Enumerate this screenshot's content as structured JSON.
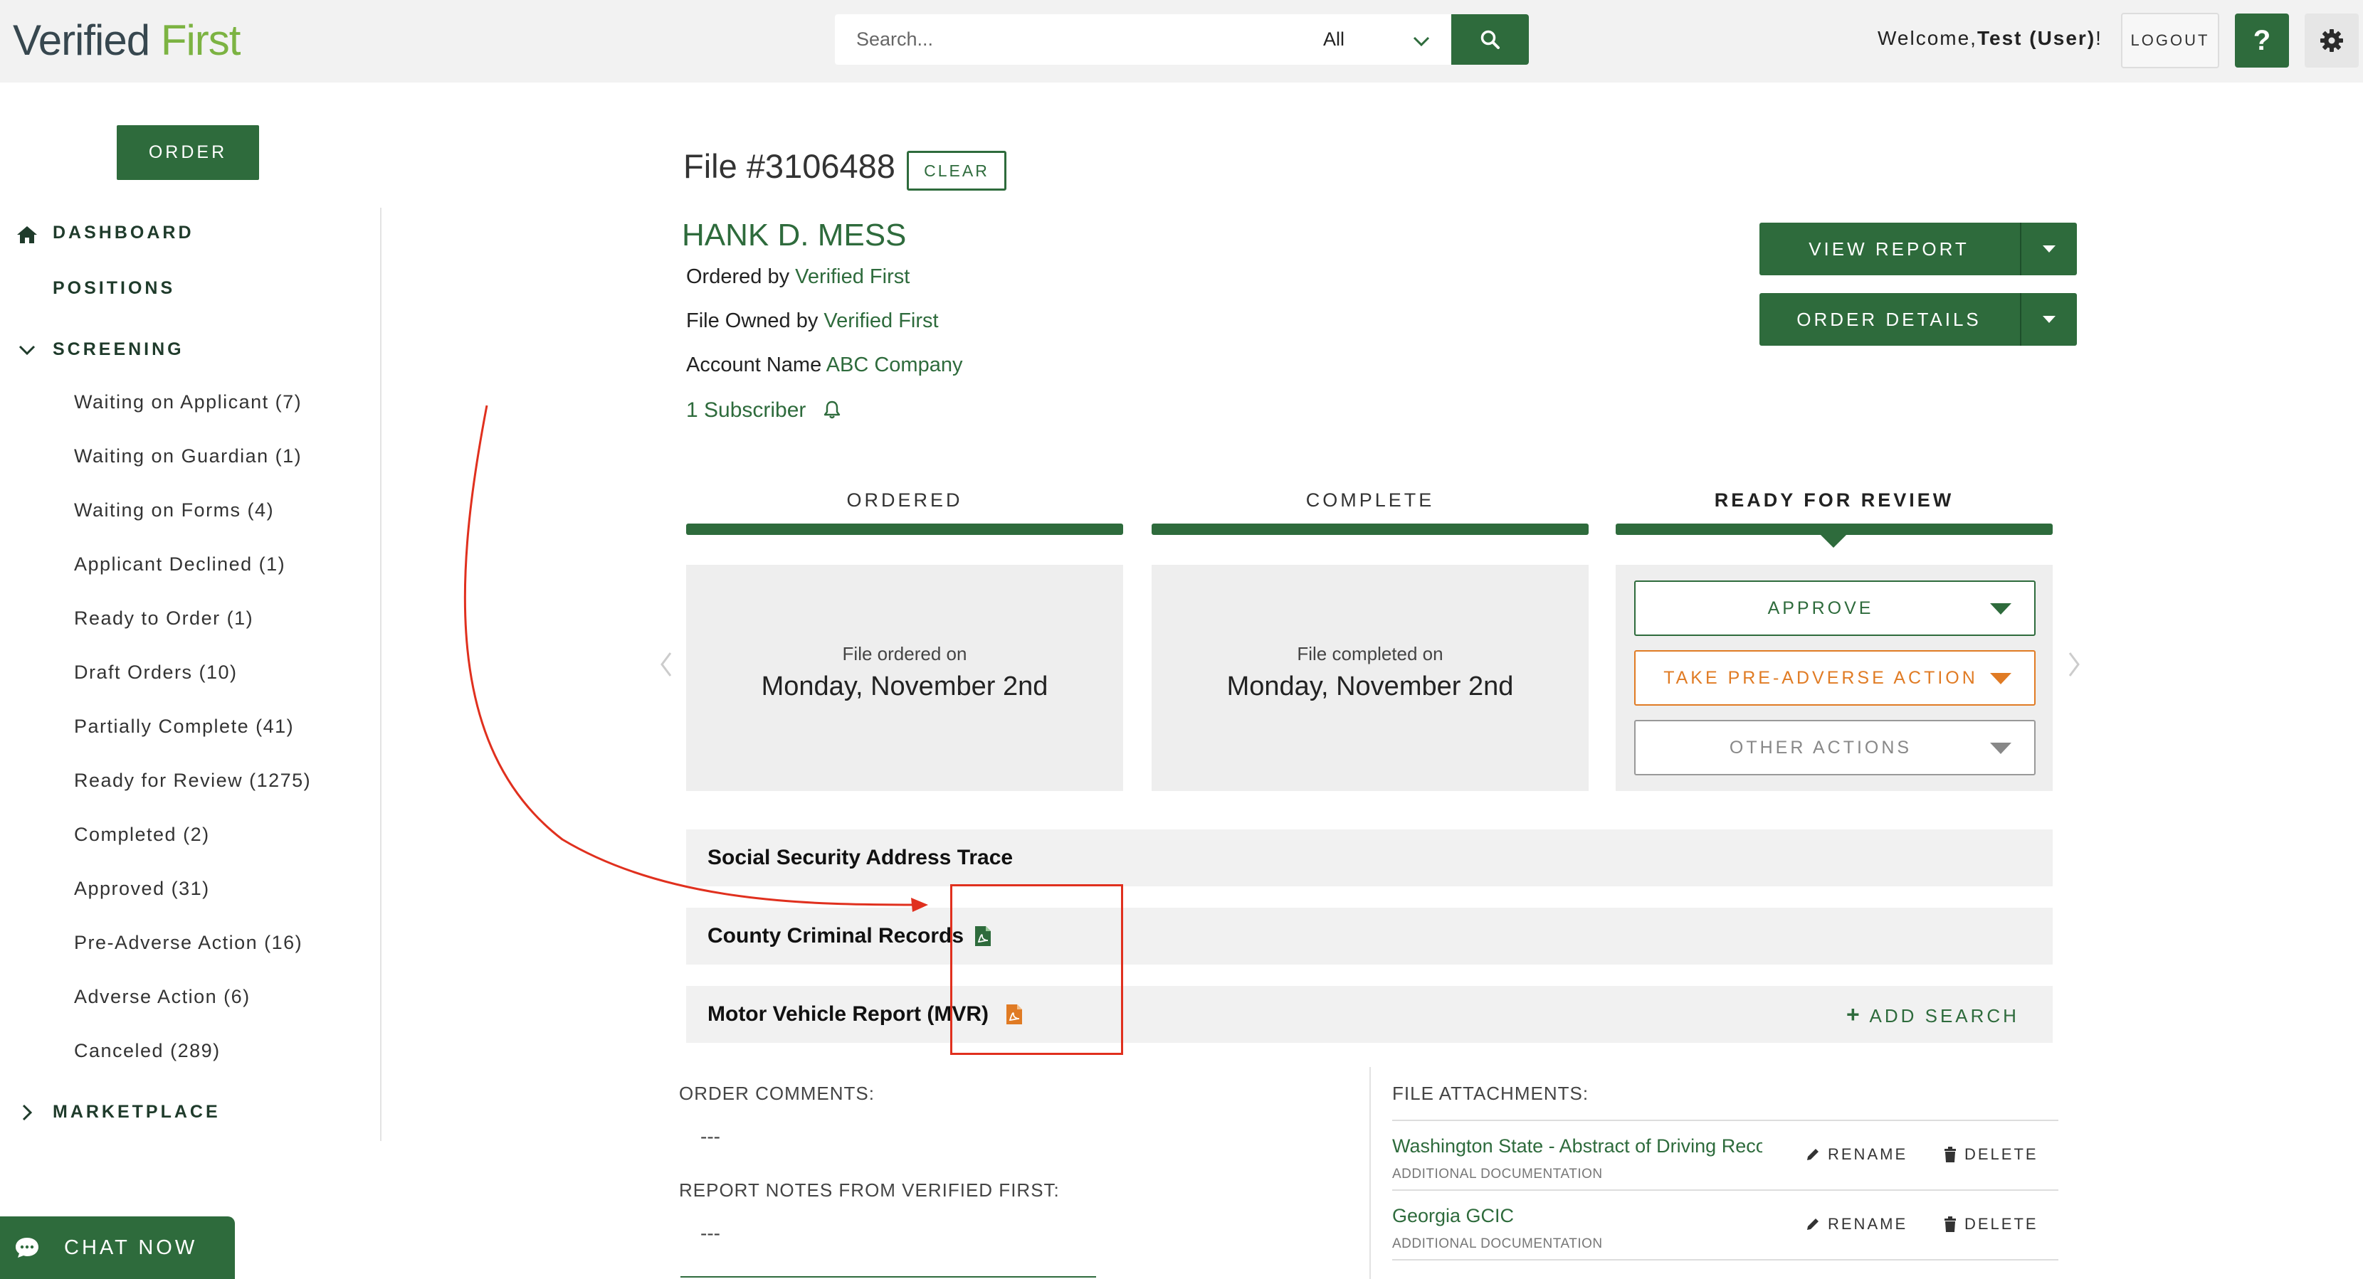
{
  "header": {
    "logo_part1": "Verified",
    "logo_part2": "First",
    "search_placeholder": "Search...",
    "search_scope": "All",
    "welcome_prefix": "Welcome,",
    "welcome_user": "Test (User)",
    "welcome_suffix": "!",
    "logout_label": "LOGOUT",
    "help_label": "?"
  },
  "sidebar": {
    "order_label": "ORDER",
    "dashboard": "DASHBOARD",
    "positions": "POSITIONS",
    "screening": "SCREENING",
    "marketplace": "MARKETPLACE",
    "items": [
      "Waiting on Applicant (7)",
      "Waiting on Guardian (1)",
      "Waiting on Forms (4)",
      "Applicant Declined (1)",
      "Ready to Order (1)",
      "Draft Orders (10)",
      "Partially Complete (41)",
      "Ready for Review (1275)",
      "Completed (2)",
      "Approved (31)",
      "Pre-Adverse Action (16)",
      "Adverse Action (6)",
      "Canceled (289)"
    ],
    "chat_label": "CHAT NOW"
  },
  "file": {
    "title": "File #3106488",
    "clear_label": "CLEAR",
    "candidate_name": "HANK D. MESS",
    "ordered_by_label": "Ordered by",
    "ordered_by_value": "Verified First",
    "owned_by_label": "File Owned by",
    "owned_by_value": "Verified First",
    "account_label": "Account Name",
    "account_value": "ABC Company",
    "subscriber_text": "1 Subscriber",
    "view_report_label": "VIEW REPORT",
    "order_details_label": "ORDER DETAILS"
  },
  "stages": {
    "ordered_label": "ORDERED",
    "complete_label": "COMPLETE",
    "review_label": "READY FOR REVIEW",
    "ordered_sub": "File ordered on",
    "ordered_date": "Monday, November 2nd",
    "completed_sub": "File completed on",
    "completed_date": "Monday, November 2nd",
    "approve_label": "APPROVE",
    "pre_adverse_label": "TAKE PRE-ADVERSE ACTION",
    "other_actions_label": "OTHER ACTIONS"
  },
  "searches": {
    "items": [
      "Social Security Address Trace",
      "County Criminal Records",
      "Motor Vehicle Report (MVR)"
    ],
    "add_search_label": "ADD SEARCH"
  },
  "comments": {
    "order_comments_label": "ORDER COMMENTS:",
    "order_comments_value": "---",
    "report_notes_label": "REPORT NOTES FROM VERIFIED FIRST:",
    "report_notes_value": "---"
  },
  "attachments": {
    "label": "FILE ATTACHMENTS:",
    "rename_label": "RENAME",
    "delete_label": "DELETE",
    "items": [
      {
        "name": "Washington State - Abstract of Driving Record",
        "type": "ADDITIONAL DOCUMENTATION"
      },
      {
        "name": "Georgia GCIC",
        "type": "ADDITIONAL DOCUMENTATION"
      }
    ]
  },
  "colors": {
    "brand_green": "#2e6b3c",
    "logo_green": "#7cb342",
    "warning_orange": "#e07b24",
    "annotation_red": "#e0301e"
  }
}
